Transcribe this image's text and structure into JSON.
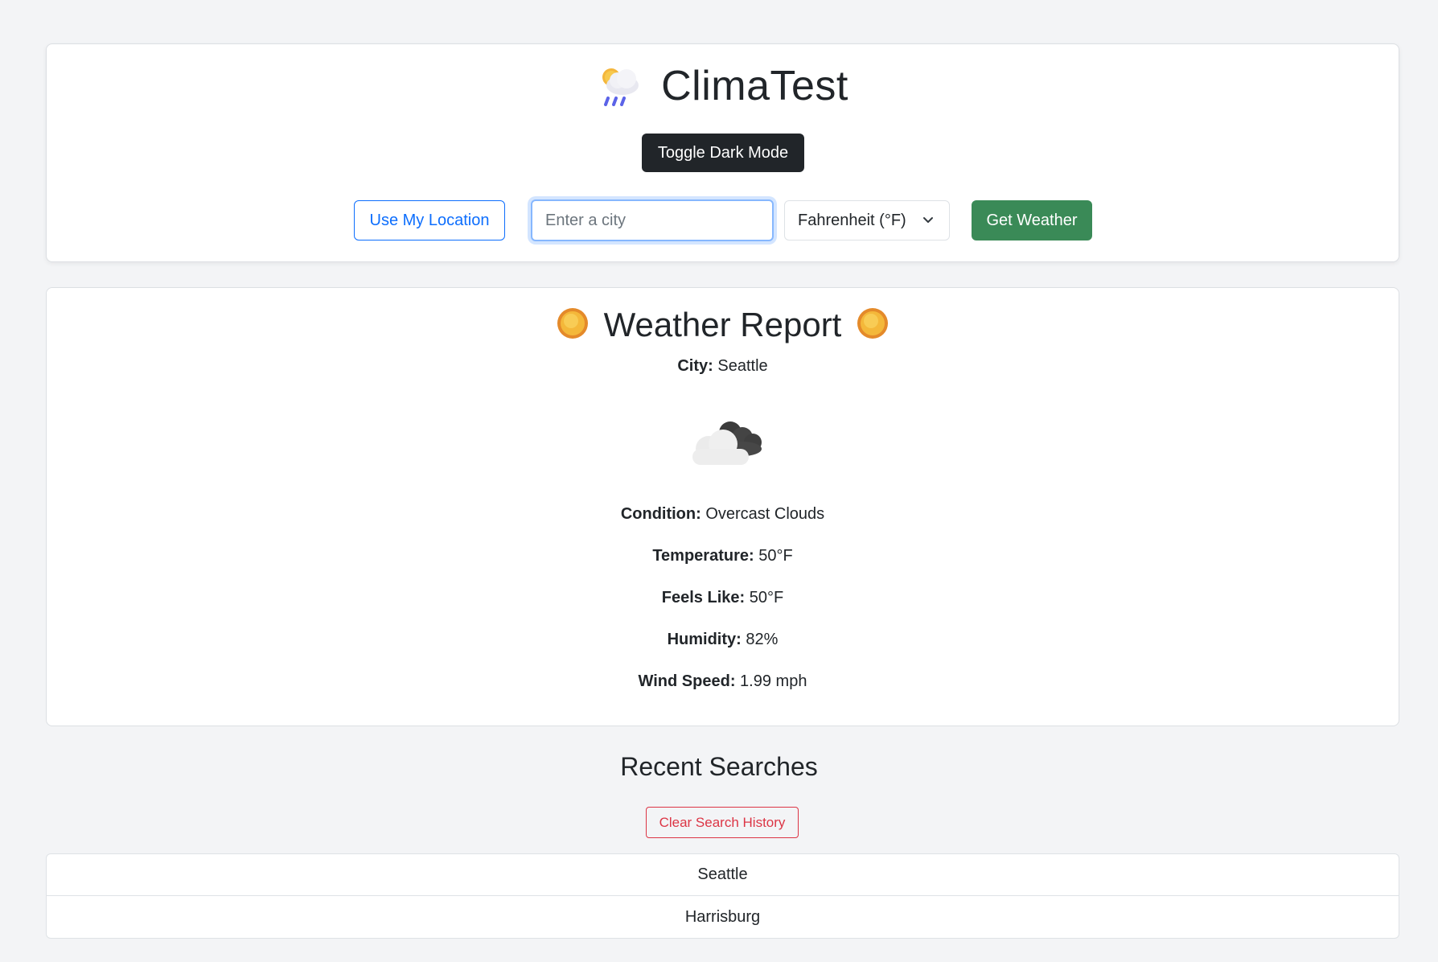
{
  "header": {
    "app_title": "ClimaTest",
    "app_icon": "sun-behind-rain-cloud-icon",
    "toggle_dark_mode_label": "Toggle Dark Mode",
    "use_location_label": "Use My Location",
    "city_input": {
      "value": "",
      "placeholder": "Enter a city"
    },
    "unit_select": {
      "selected": "Fahrenheit (°F)",
      "icon": "chevron-down-icon"
    },
    "get_weather_label": "Get Weather"
  },
  "report": {
    "title": "Weather Report",
    "title_icon": "sun-icon",
    "city_label": "City:",
    "city_value": "Seattle",
    "condition_icon": "overcast-clouds-icon",
    "condition_label": "Condition:",
    "condition_value": "Overcast Clouds",
    "temperature_label": "Temperature:",
    "temperature_value": "50°F",
    "feels_like_label": "Feels Like:",
    "feels_like_value": "50°F",
    "humidity_label": "Humidity:",
    "humidity_value": "82%",
    "wind_label": "Wind Speed:",
    "wind_value": "1.99 mph"
  },
  "recent": {
    "title": "Recent Searches",
    "clear_label": "Clear Search History",
    "items": [
      "Seattle",
      "Harrisburg"
    ]
  },
  "colors": {
    "background": "#f3f4f6",
    "primary": "#0d6efd",
    "success": "#3a8a57",
    "danger": "#dc3545",
    "dark": "#212529"
  }
}
